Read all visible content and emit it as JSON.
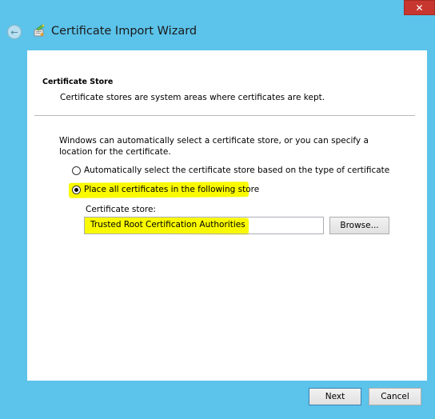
{
  "window": {
    "close_label": "✕",
    "title": "Certificate Import Wizard"
  },
  "page": {
    "section_title": "Certificate Store",
    "section_desc": "Certificate stores are system areas where certificates are kept.",
    "intro": "Windows can automatically select a certificate store, or you can specify a location for the certificate.",
    "option_auto": {
      "label": "Automatically select the certificate store based on the type of certificate",
      "checked": false
    },
    "option_place": {
      "label": "Place all certificates in the following store",
      "checked": true
    },
    "store_label": "Certificate store:",
    "store_value": "Trusted Root Certification Authorities",
    "browse_label": "Browse..."
  },
  "footer": {
    "next_label": "Next",
    "cancel_label": "Cancel"
  },
  "colors": {
    "chrome": "#5cc3ea",
    "highlight": "#f9f900",
    "close": "#c7372f"
  },
  "icons": {
    "back": "back-arrow-icon",
    "wizard": "certificate-wizard-icon",
    "close": "close-icon"
  }
}
